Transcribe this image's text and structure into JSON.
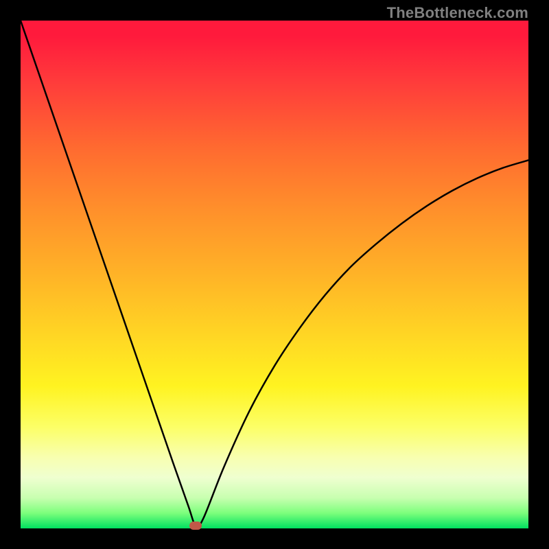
{
  "watermark": "TheBottleneck.com",
  "chart_data": {
    "type": "line",
    "title": "",
    "xlabel": "",
    "ylabel": "",
    "xlim": [
      0,
      100
    ],
    "ylim": [
      0,
      100
    ],
    "grid": false,
    "legend": false,
    "series": [
      {
        "name": "bottleneck-curve",
        "x": [
          0,
          5,
          10,
          15,
          20,
          25,
          30,
          33,
          34.5,
          36,
          40,
          45,
          50,
          55,
          60,
          65,
          70,
          75,
          80,
          85,
          90,
          95,
          100
        ],
        "y": [
          100,
          85.5,
          71,
          56.5,
          42,
          27.5,
          13,
          4.5,
          0.5,
          2,
          12,
          23,
          32,
          39.5,
          46,
          51.5,
          56,
          60,
          63.5,
          66.5,
          69,
          71,
          72.5
        ]
      }
    ],
    "marker": {
      "x": 34.5,
      "y": 0.5,
      "color": "#c05848"
    },
    "background_gradient": [
      "#ff1a3c",
      "#ff8f2b",
      "#fff321",
      "#00e060"
    ]
  }
}
